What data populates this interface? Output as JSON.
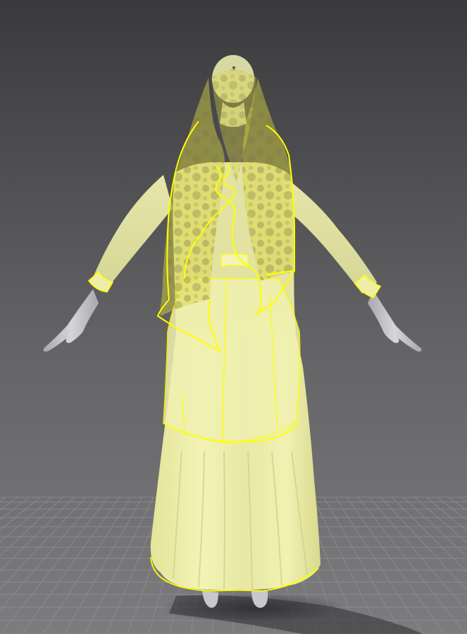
{
  "viewport": {
    "background_top": "#3c3c3e",
    "background_bottom": "#7a7a7c",
    "grid_color": "#8f8f91",
    "avatar_color": "#c9c9cb",
    "garment_fill": "#f0f0a8",
    "garment_outline": "#ffff00",
    "veil_fill": "#d9d640",
    "shadow_color": "#2e2e30"
  }
}
